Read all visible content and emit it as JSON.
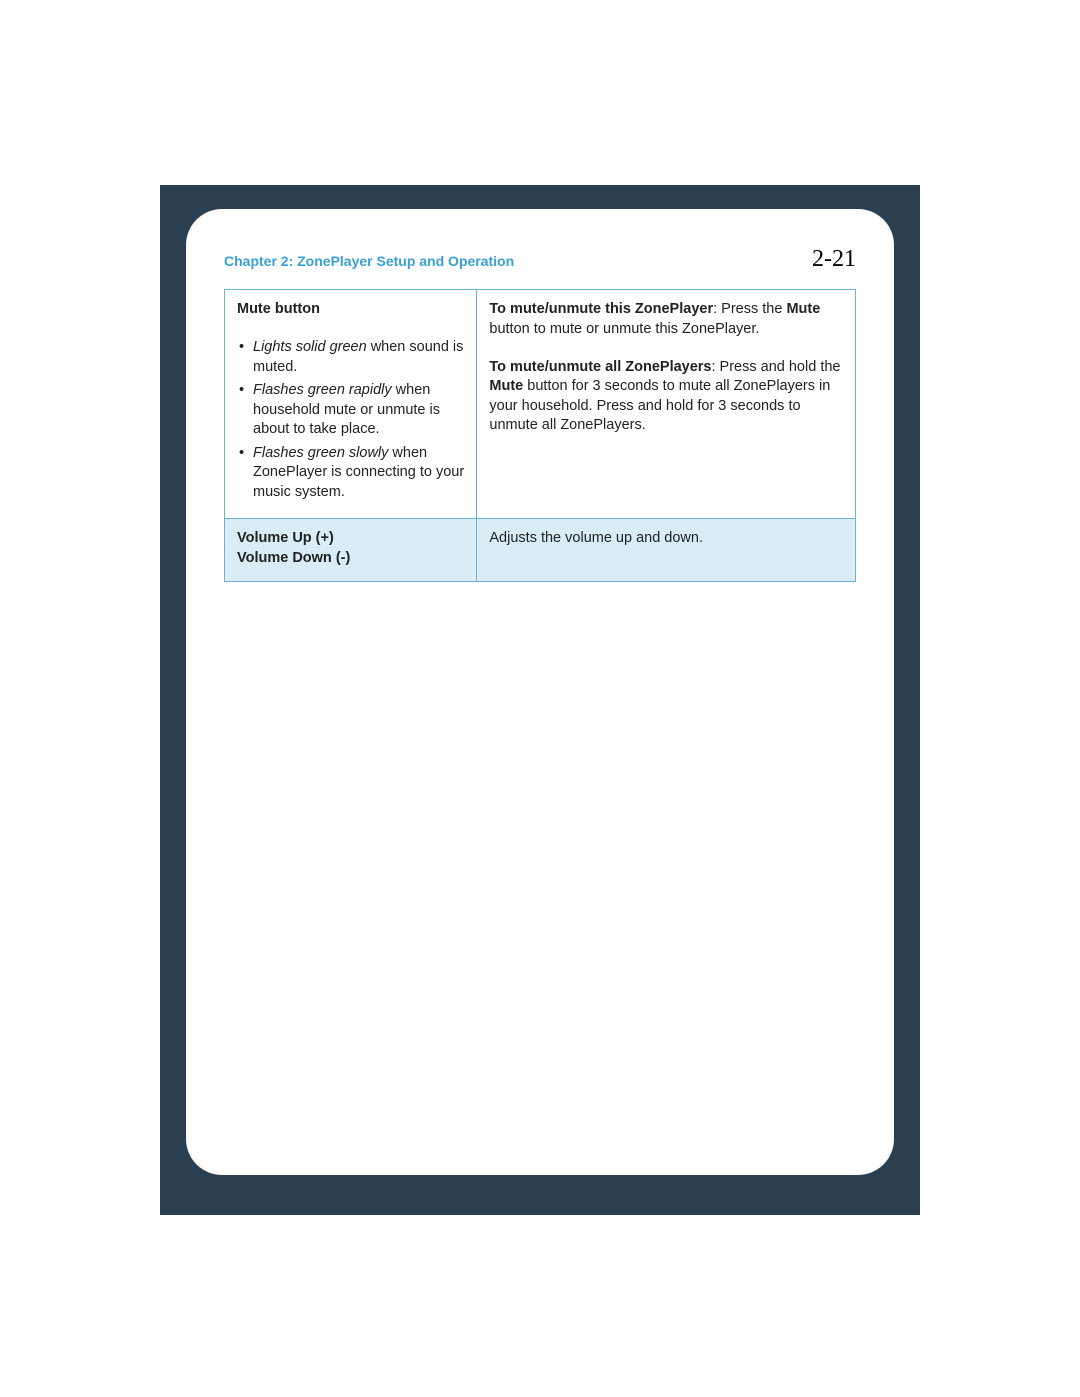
{
  "header": {
    "chapter": "Chapter 2:  ZonePlayer Setup and Operation",
    "page": "2-21"
  },
  "table": {
    "row1": {
      "left_title": "Mute button",
      "bullets": [
        {
          "em": "Lights solid green",
          "rest": " when sound is muted."
        },
        {
          "em": "Flashes green rapidly",
          "rest": " when household mute or unmute is about to take place."
        },
        {
          "em": "Flashes green slowly",
          "rest": " when ZonePlayer is connecting to your music system."
        }
      ],
      "right": {
        "p1_b": "To mute/unmute this ZonePlayer",
        "p1_mid": ": Press the ",
        "p1_b2": "Mute",
        "p1_end": " button to mute or unmute this ZonePlayer.",
        "p2_b": "To mute/unmute all ZonePlayers",
        "p2_mid": ": Press and hold the ",
        "p2_b2": "Mute",
        "p2_end": " button for 3 seconds to mute all ZonePlayers in your household. Press and hold for 3 seconds to unmute all ZonePlayers."
      }
    },
    "row2": {
      "left_line1": "Volume Up (+)",
      "left_line2": "Volume Down (-)",
      "right": "Adjusts the volume up and down."
    }
  }
}
